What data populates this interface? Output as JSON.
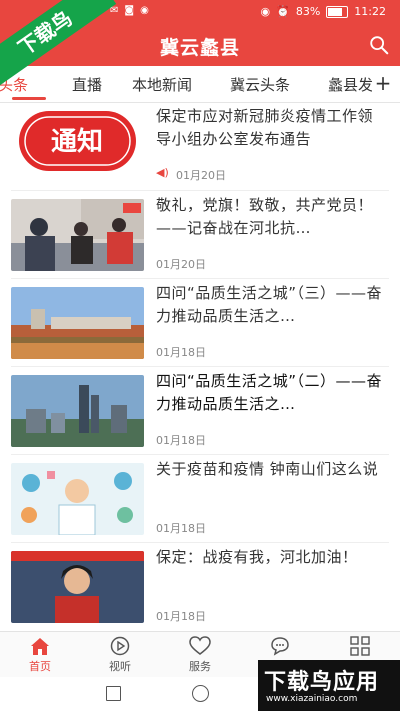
{
  "status_bar": {
    "battery_text": "83%",
    "time": "11:22",
    "battery_level": 0.83
  },
  "app": {
    "title": "冀云蠡县"
  },
  "watermark": {
    "corner_text": "下载鸟",
    "brand_text": "下载鸟应用",
    "brand_url": "www.xiazainiao.com"
  },
  "tabs": [
    {
      "label": "头条"
    },
    {
      "label": "直播"
    },
    {
      "label": "本地新闻"
    },
    {
      "label": "冀云头条"
    },
    {
      "label": "蠡县发布"
    }
  ],
  "news": [
    {
      "title": "保定市应对新冠肺炎疫情工作领导小组办公室发布通告",
      "date": "01月20日",
      "thumb_text": "通知"
    },
    {
      "title": "敬礼，党旗！致敬，共产党员！——记奋战在河北抗…",
      "date": "01月20日"
    },
    {
      "title": "四问“品质生活之城”（三）——奋力推动品质生活之…",
      "date": "01月18日"
    },
    {
      "title": "四问“品质生活之城”（二）——奋力推动品质生活之…",
      "date": "01月18日"
    },
    {
      "title": "关于疫苗和疫情 钟南山们这么说",
      "date": "01月18日"
    },
    {
      "title": "保定：战疫有我，河北加油！",
      "date": "01月18日"
    }
  ],
  "bottom_nav": [
    {
      "label": "首页"
    },
    {
      "label": "视听"
    },
    {
      "label": "服务"
    },
    {
      "label": ""
    },
    {
      "label": ""
    }
  ]
}
